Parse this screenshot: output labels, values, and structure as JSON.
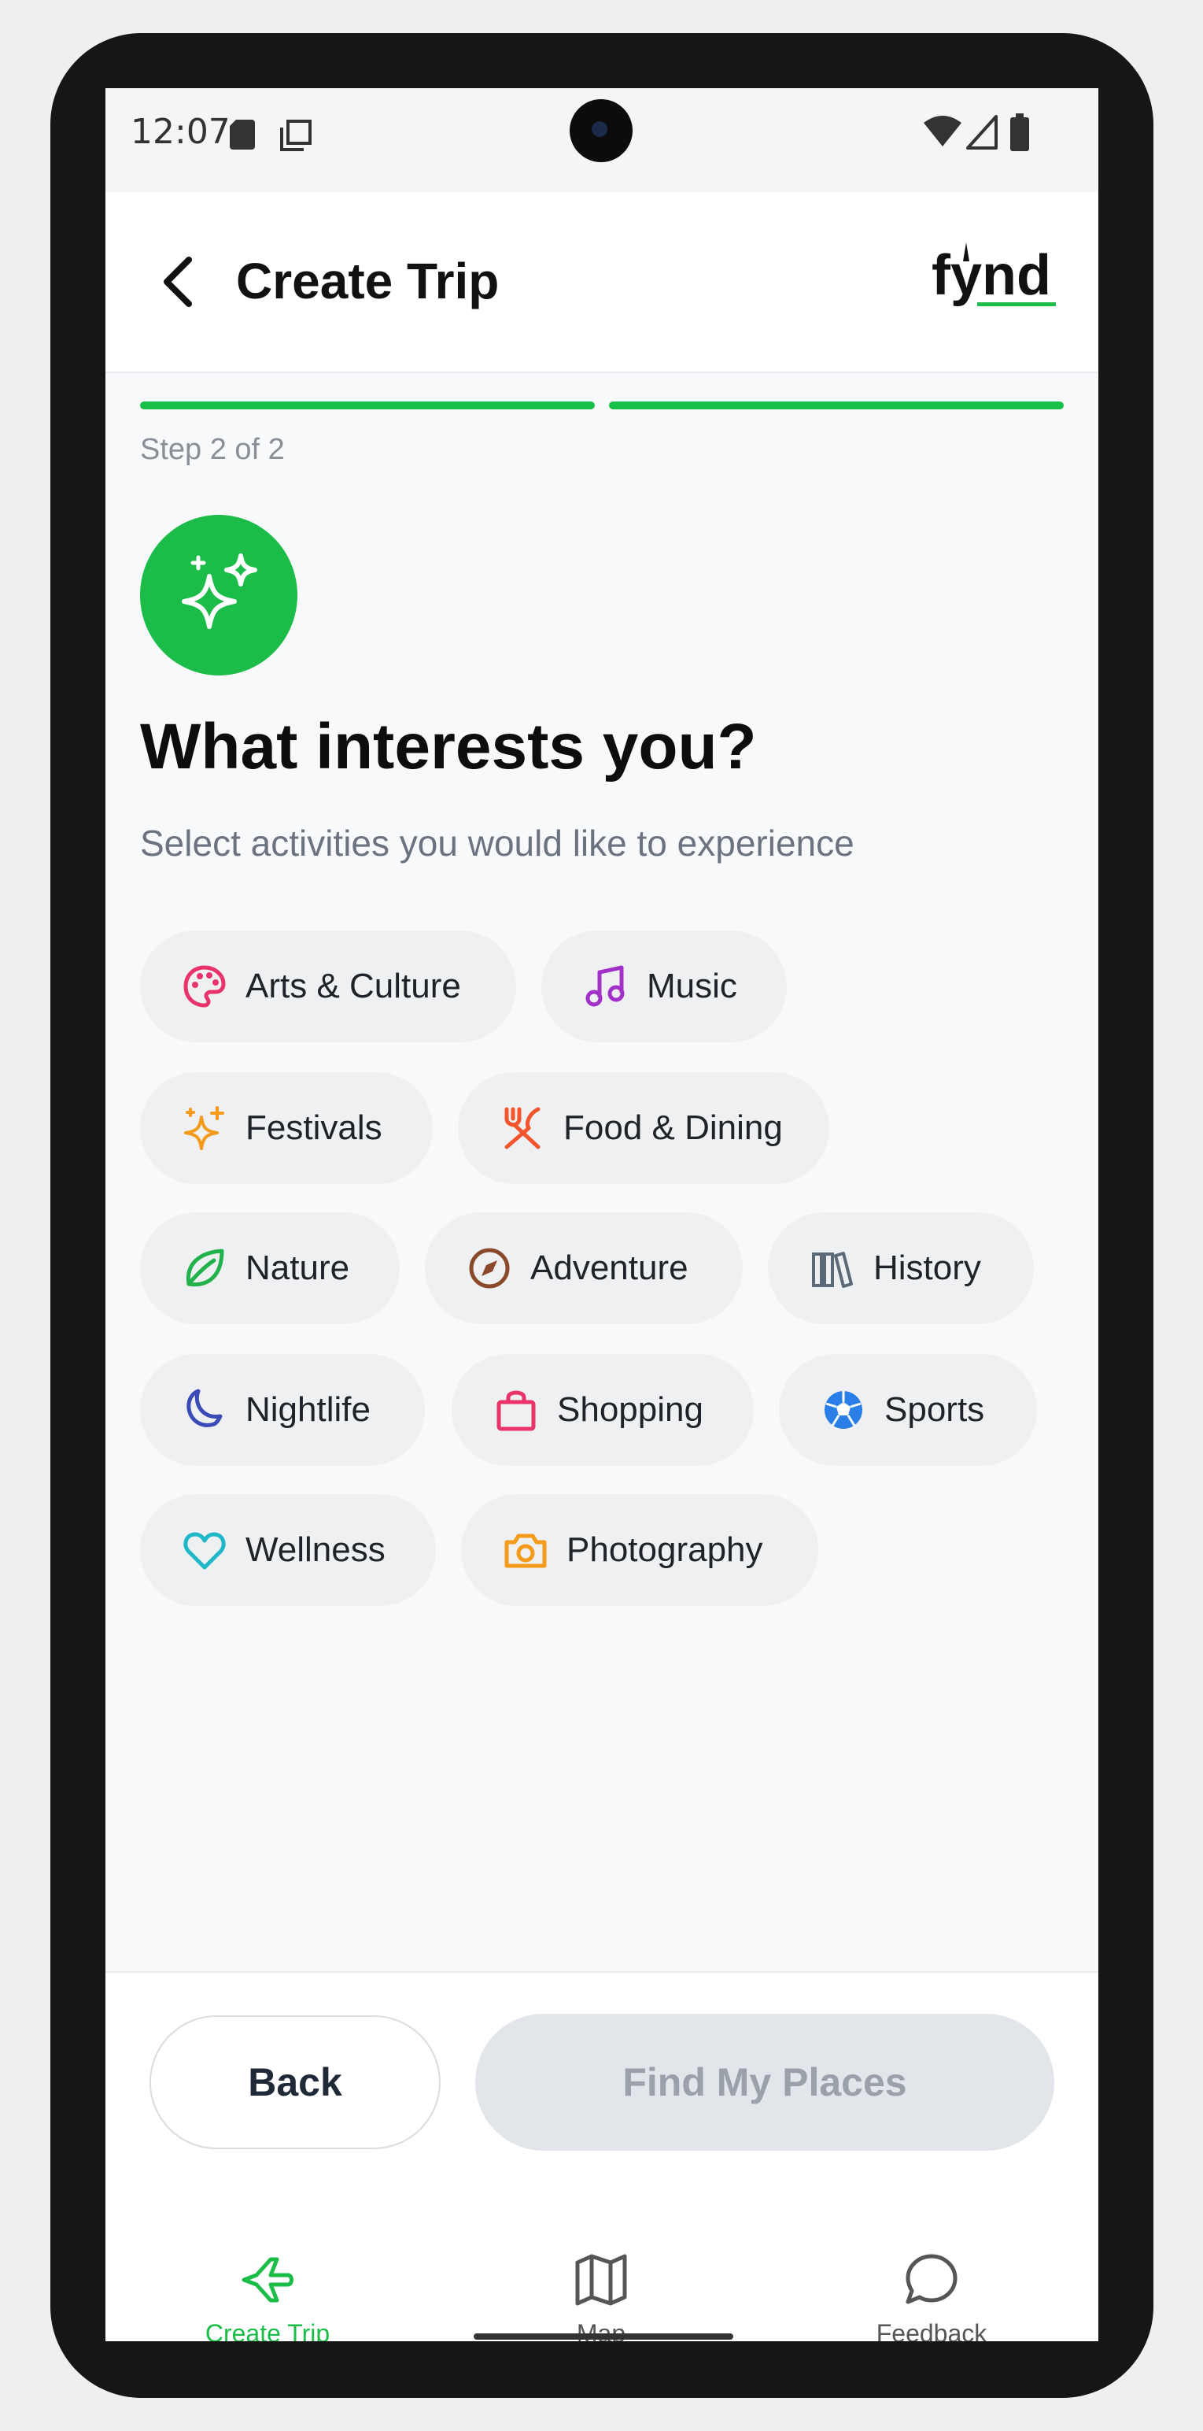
{
  "status_bar": {
    "time": "12:07"
  },
  "header": {
    "title": "Create Trip",
    "logo_text": "fynd"
  },
  "progress": {
    "step_label": "Step 2 of 2",
    "segments_completed": 2,
    "segments_total": 2
  },
  "main": {
    "heading": "What interests you?",
    "subheading": "Select activities you would like to experience"
  },
  "interests": [
    {
      "label": "Arts & Culture",
      "icon": "palette-icon",
      "color": "#e8336b"
    },
    {
      "label": "Music",
      "icon": "music-note-icon",
      "color": "#a330c8"
    },
    {
      "label": "Festivals",
      "icon": "sparkles-icon",
      "color": "#f59a1b"
    },
    {
      "label": "Food & Dining",
      "icon": "utensils-icon",
      "color": "#f2552b"
    },
    {
      "label": "Nature",
      "icon": "leaf-icon",
      "color": "#22b24c"
    },
    {
      "label": "Adventure",
      "icon": "compass-icon",
      "color": "#8a4a2a"
    },
    {
      "label": "History",
      "icon": "library-icon",
      "color": "#5a6a78"
    },
    {
      "label": "Nightlife",
      "icon": "moon-icon",
      "color": "#3a4bb8"
    },
    {
      "label": "Shopping",
      "icon": "shopping-bag-icon",
      "color": "#e8336b"
    },
    {
      "label": "Sports",
      "icon": "soccer-ball-icon",
      "color": "#2a7ee8"
    },
    {
      "label": "Wellness",
      "icon": "heart-icon",
      "color": "#1fb8c8"
    },
    {
      "label": "Photography",
      "icon": "camera-icon",
      "color": "#f59a1b"
    }
  ],
  "actions": {
    "back_label": "Back",
    "find_label": "Find My Places"
  },
  "bottom_nav": [
    {
      "label": "Create Trip",
      "icon": "plane-icon",
      "active": true
    },
    {
      "label": "Map",
      "icon": "map-icon",
      "active": false
    },
    {
      "label": "Feedback",
      "icon": "chat-bubble-icon",
      "active": false
    }
  ],
  "colors": {
    "accent": "#1bbc47",
    "muted_button": "#e2e5ea",
    "chip_bg": "#eff0f2"
  }
}
